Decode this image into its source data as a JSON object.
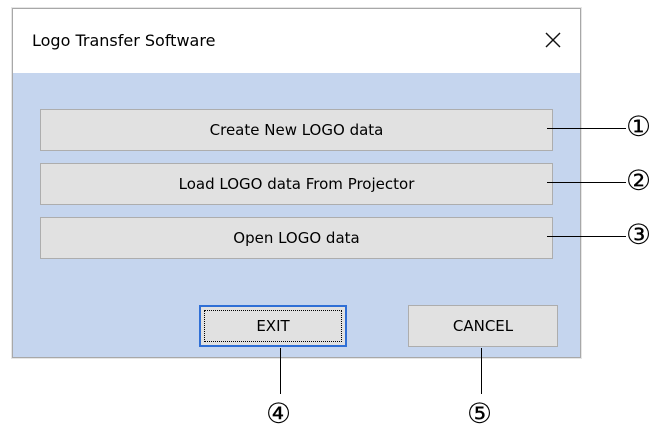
{
  "window": {
    "title": "Logo Transfer Software"
  },
  "buttons": {
    "create": "Create New LOGO data",
    "load": "Load LOGO data From Projector",
    "open": "Open LOGO data",
    "exit": "EXIT",
    "cancel": "CANCEL"
  },
  "annotations": {
    "one": "①",
    "two": "②",
    "three": "③",
    "four": "④",
    "five": "⑤"
  },
  "icons": {
    "close": "close-icon"
  }
}
